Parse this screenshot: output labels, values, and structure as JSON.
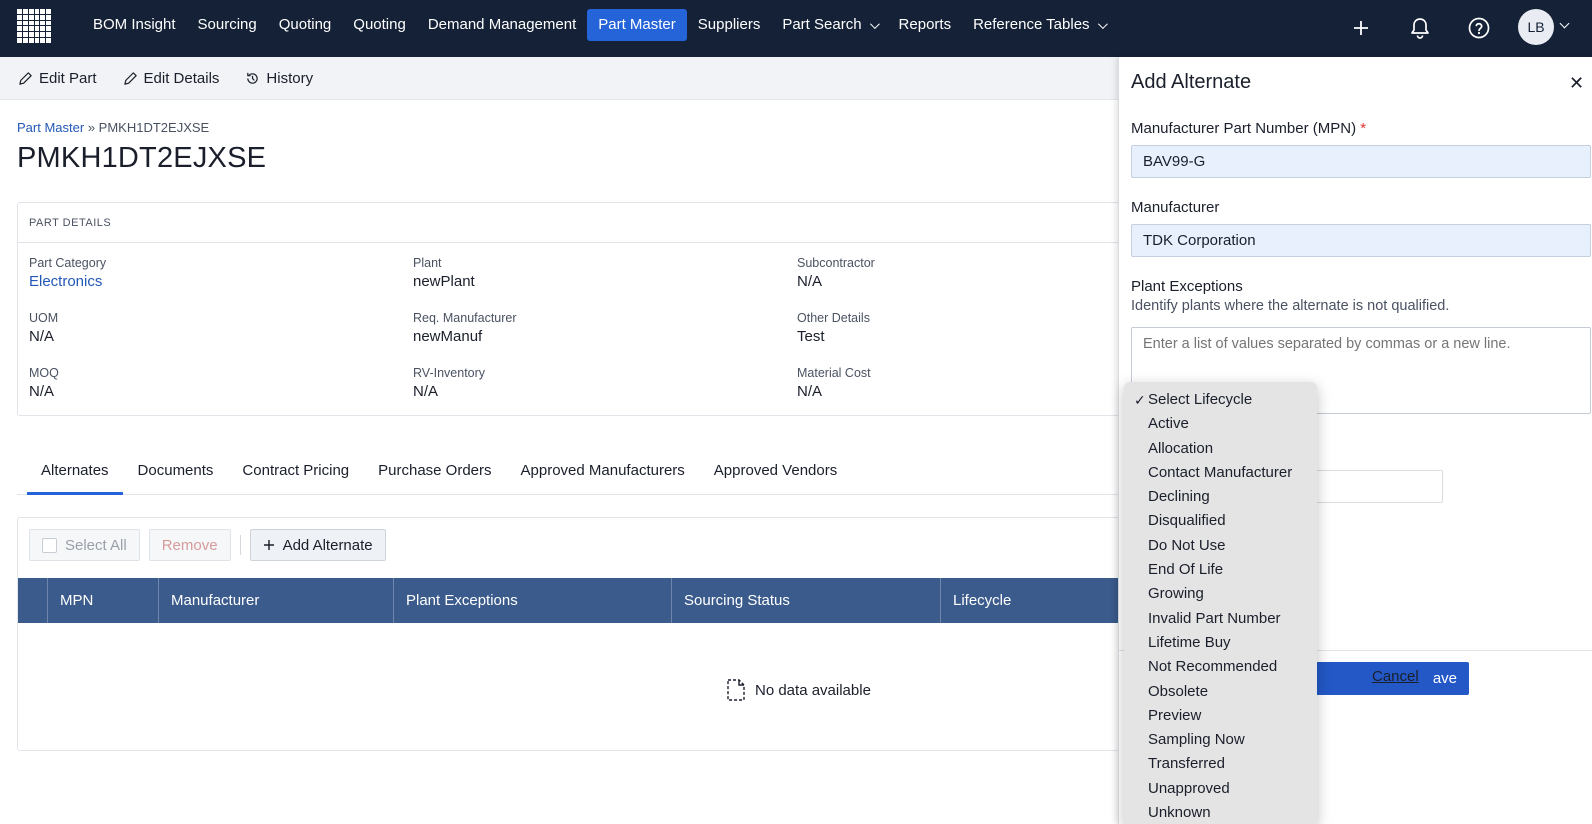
{
  "nav": {
    "items": [
      {
        "label": "BOM Insight",
        "active": false,
        "dropdown": false
      },
      {
        "label": "Sourcing",
        "active": false,
        "dropdown": false
      },
      {
        "label": "Quoting",
        "active": false,
        "dropdown": false
      },
      {
        "label": "Quoting",
        "active": false,
        "dropdown": false
      },
      {
        "label": "Demand Management",
        "active": false,
        "dropdown": false
      },
      {
        "label": "Part Master",
        "active": true,
        "dropdown": false
      },
      {
        "label": "Suppliers",
        "active": false,
        "dropdown": false
      },
      {
        "label": "Part Search",
        "active": false,
        "dropdown": true
      },
      {
        "label": "Reports",
        "active": false,
        "dropdown": false
      },
      {
        "label": "Reference Tables",
        "active": false,
        "dropdown": true
      }
    ],
    "avatar_initials": "LB",
    "icons": [
      "plus-icon",
      "bell-icon",
      "help-icon"
    ],
    "accent": "#2563d8",
    "bg": "#142136"
  },
  "toolbar": {
    "edit_part": "Edit Part",
    "edit_details": "Edit Details",
    "history": "History"
  },
  "breadcrumb": {
    "root": "Part Master",
    "separator": "»",
    "current": "PMKH1DT2EJXSE"
  },
  "page_title": "PMKH1DT2EJXSE",
  "part_details": {
    "header": "PART DETAILS",
    "fields": [
      {
        "label": "Part Category",
        "value": "Electronics",
        "link": true
      },
      {
        "label": "Plant",
        "value": "newPlant",
        "link": false
      },
      {
        "label": "Subcontractor",
        "value": "N/A",
        "link": false
      },
      {
        "label": "UOM",
        "value": "N/A",
        "link": false
      },
      {
        "label": "Req. Manufacturer",
        "value": "newManuf",
        "link": false
      },
      {
        "label": "Other Details",
        "value": "Test",
        "link": false
      },
      {
        "label": "MOQ",
        "value": "N/A",
        "link": false
      },
      {
        "label": "RV-Inventory",
        "value": "N/A",
        "link": false
      },
      {
        "label": "Material Cost",
        "value": "N/A",
        "link": false
      }
    ]
  },
  "tabs": [
    "Alternates",
    "Documents",
    "Contract Pricing",
    "Purchase Orders",
    "Approved Manufacturers",
    "Approved Vendors"
  ],
  "table": {
    "select_all": "Select All",
    "remove": "Remove",
    "add_alternate": "Add Alternate",
    "columns": [
      "MPN",
      "Manufacturer",
      "Plant Exceptions",
      "Sourcing Status",
      "Lifecycle"
    ],
    "empty_text": "No data available"
  },
  "side_panel": {
    "title": "Add Alternate",
    "mpn_label": "Manufacturer Part Number (MPN)",
    "mpn_required": "*",
    "mpn_value": "BAV99-G",
    "manufacturer_label": "Manufacturer",
    "manufacturer_value": "TDK Corporation",
    "plant_exceptions_label": "Plant Exceptions",
    "plant_exceptions_help": "Identify plants where the alternate is not qualified.",
    "plant_exceptions_placeholder": "Enter a list of values separated by commas or a new line.",
    "save_label": "ave",
    "cancel_label": "Cancel"
  },
  "lifecycle_dropdown": {
    "selected": "Select Lifecycle",
    "options": [
      "Select Lifecycle",
      "Active",
      "Allocation",
      "Contact Manufacturer",
      "Declining",
      "Disqualified",
      "Do Not Use",
      "End Of Life",
      "Growing",
      "Invalid Part Number",
      "Lifetime Buy",
      "Not Recommended",
      "Obsolete",
      "Preview",
      "Sampling Now",
      "Transferred",
      "Unapproved",
      "Unknown"
    ]
  }
}
